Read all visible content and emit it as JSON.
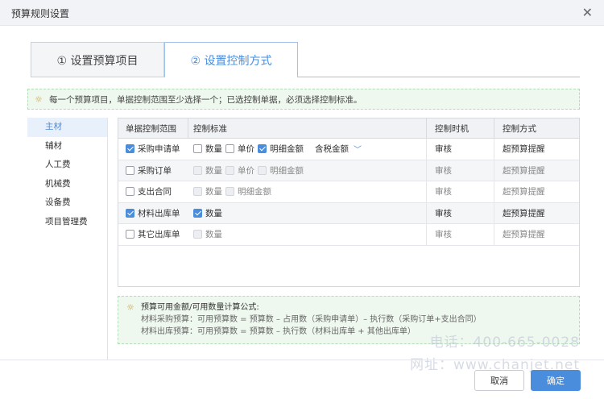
{
  "dialog": {
    "title": "预算规则设置",
    "close_glyph": "✕"
  },
  "tabs": [
    {
      "label": "① 设置预算项目",
      "active": false
    },
    {
      "label": "② 设置控制方式",
      "active": true
    }
  ],
  "tip": {
    "icon": "lightbulb-icon",
    "text": "每一个预算项目，单据控制范围至少选择一个；已选控制单据，必须选择控制标准。"
  },
  "sidebar": {
    "items": [
      {
        "label": "主材",
        "active": true
      },
      {
        "label": "辅材"
      },
      {
        "label": "人工费"
      },
      {
        "label": "机械费"
      },
      {
        "label": "设备费"
      },
      {
        "label": "项目管理费"
      }
    ]
  },
  "table": {
    "headers": {
      "scope": "单据控制范围",
      "standard": "控制标准",
      "timing": "控制时机",
      "method": "控制方式"
    },
    "rows": [
      {
        "doc": "采购申请单",
        "doc_checked": true,
        "qty": "数量",
        "price": "单价",
        "amount": "明细金额",
        "tax": "含税金额",
        "timing": "审核",
        "method": "超预算提醒"
      },
      {
        "doc": "采购订单",
        "doc_checked": false,
        "qty": "数量",
        "price": "单价",
        "amount": "明细金额",
        "timing": "审核",
        "method": "超预算提醒"
      },
      {
        "doc": "支出合同",
        "doc_checked": false,
        "qty": "数量",
        "amount": "明细金额",
        "timing": "审核",
        "method": "超预算提醒"
      },
      {
        "doc": "材料出库单",
        "doc_checked": true,
        "qty": "数量",
        "timing": "审核",
        "method": "超预算提醒"
      },
      {
        "doc": "其它出库单",
        "doc_checked": false,
        "qty": "数量",
        "timing": "审核",
        "method": "超预算提醒"
      }
    ]
  },
  "formula": {
    "title": "预算可用金额/可用数量计算公式:",
    "line1": "材料采购预算：可用预算数 = 预算数 – 占用数（采购申请单）– 执行数（采购订单+支出合同）",
    "line2": "材料出库预算：可用预算数 = 预算数 – 执行数（材料出库单 + 其他出库单）"
  },
  "buttons": {
    "cancel": "取消",
    "ok": "确定"
  },
  "watermark": {
    "phone": "电话：400-665-0028",
    "site": "网址：www.chanjet.net"
  },
  "colors": {
    "accent": "#4a8ddc",
    "tip_bg": "#eef8ef",
    "tip_border": "#b5dcb9"
  }
}
